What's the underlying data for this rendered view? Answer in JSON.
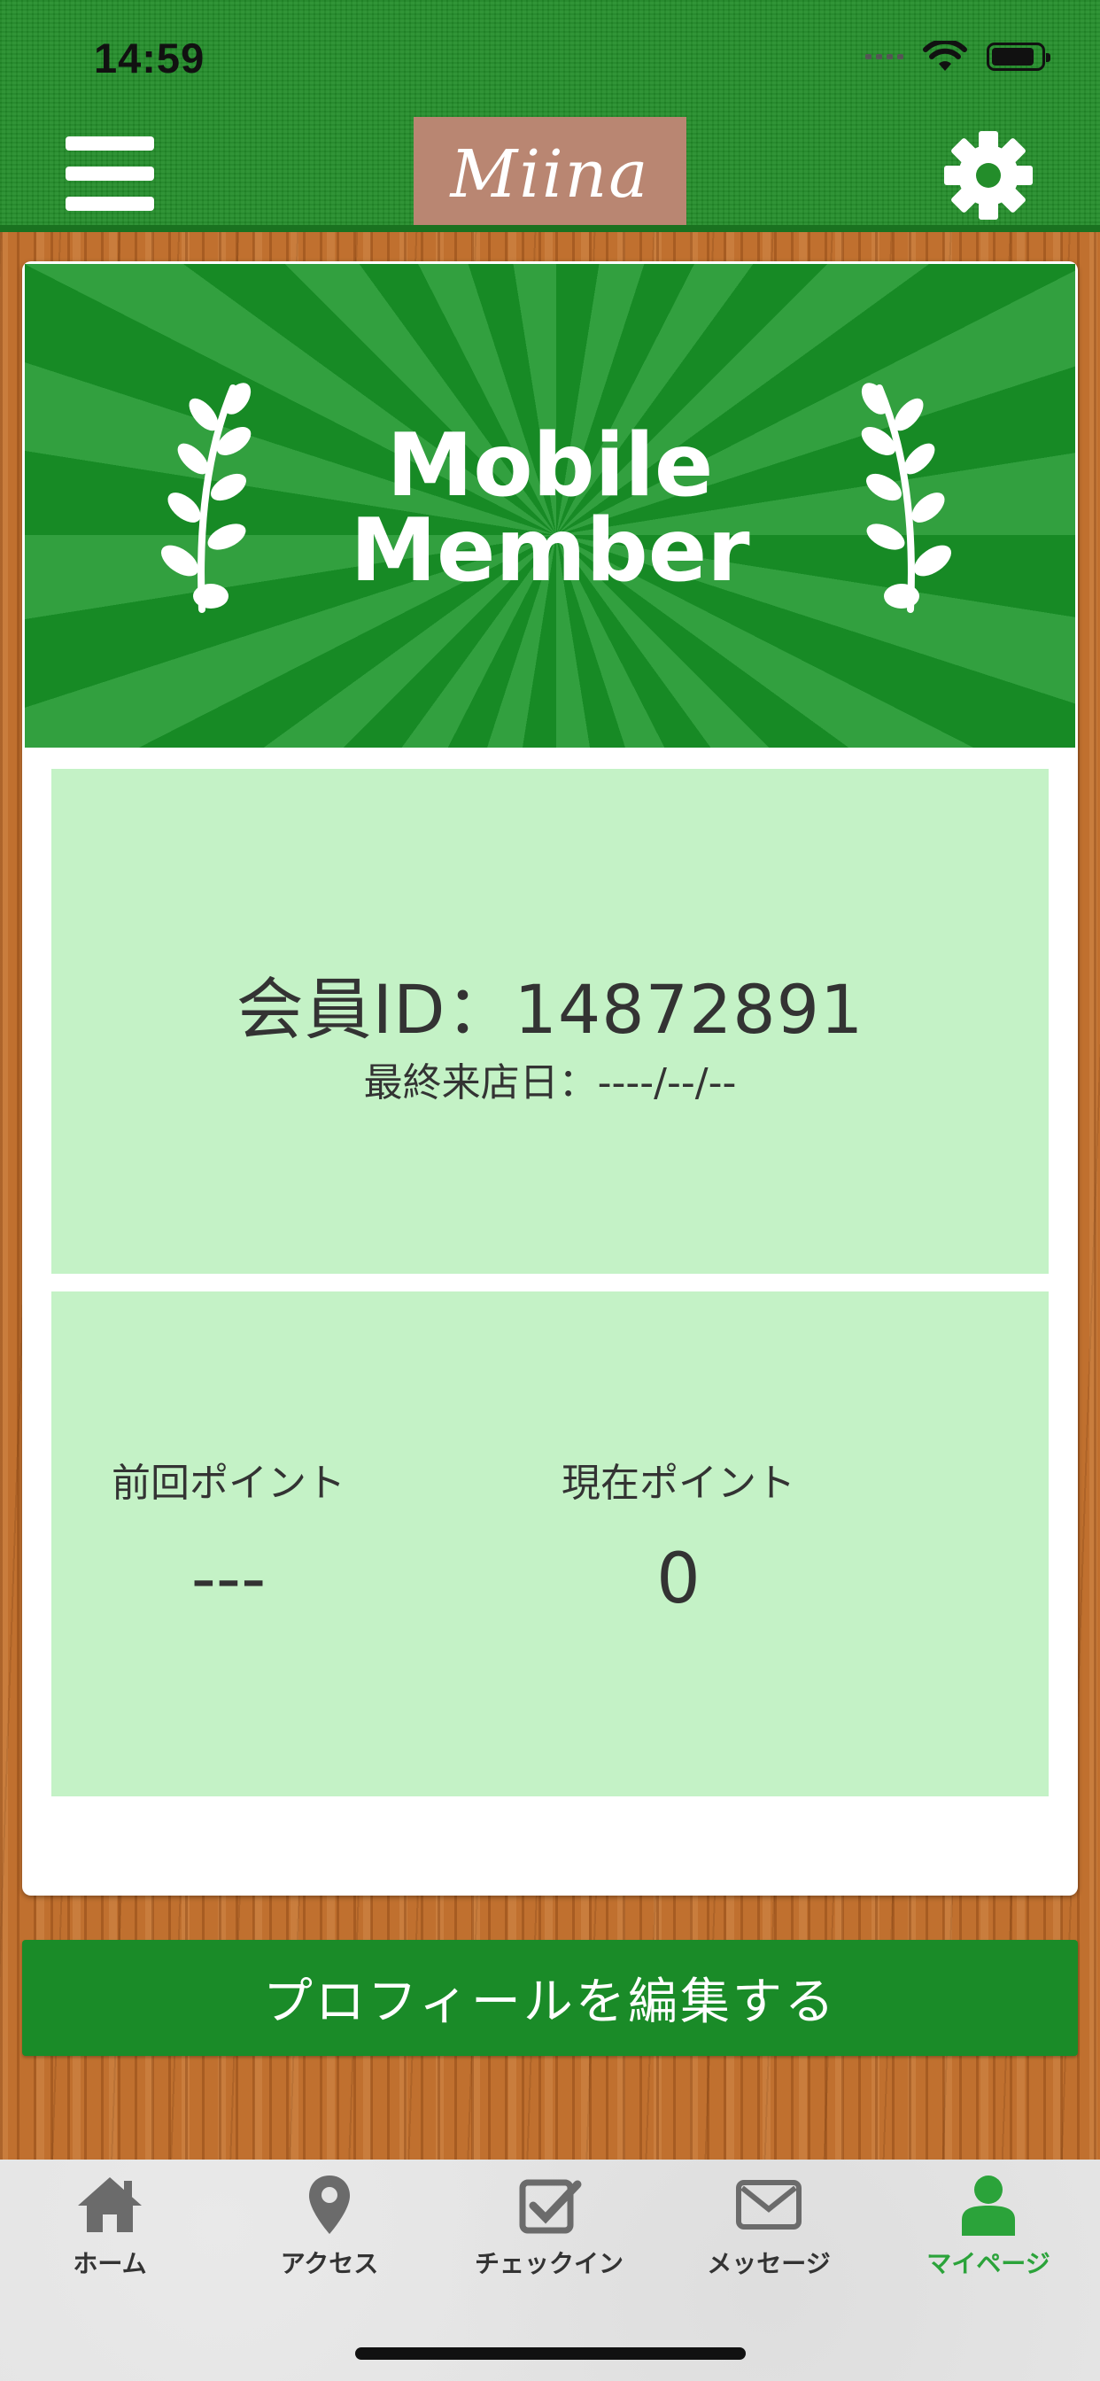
{
  "status_bar": {
    "time": "14:59"
  },
  "header": {
    "logo_text": "Miina",
    "menu_icon": "hamburger-menu-icon",
    "settings_icon": "gear-icon"
  },
  "banner": {
    "line1": "Mobile",
    "line2": "Member"
  },
  "member": {
    "id_text": "会員ID：14872891",
    "last_visit_text": "最終来店日：----/--/--"
  },
  "points": {
    "previous_label": "前回ポイント",
    "previous_value": "---",
    "current_label": "現在ポイント",
    "current_value": "0"
  },
  "edit_profile_label": "プロフィールを編集する",
  "tabs": [
    {
      "label": "ホーム",
      "icon": "home-icon"
    },
    {
      "label": "アクセス",
      "icon": "map-pin-icon"
    },
    {
      "label": "チェックイン",
      "icon": "checkin-icon"
    },
    {
      "label": "メッセージ",
      "icon": "mail-icon"
    },
    {
      "label": "マイページ",
      "icon": "user-icon",
      "active": true
    }
  ],
  "colors": {
    "header_green": "#238d2a",
    "button_green": "#1a8b28",
    "panel_green": "#c4f2c6",
    "active_tab": "#2ba33a"
  }
}
